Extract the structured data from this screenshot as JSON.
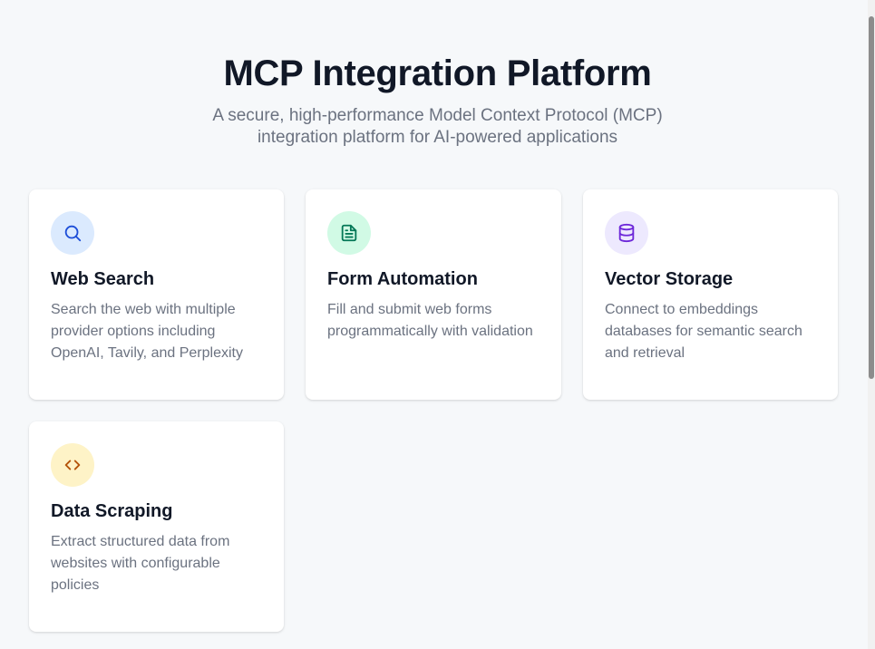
{
  "hero": {
    "title": "MCP Integration Platform",
    "subtitle": "A secure, high-performance Model Context Protocol (MCP) integration platform for AI-powered applications"
  },
  "features": [
    {
      "title": "Web Search",
      "description": "Search the web with multiple provider options including OpenAI, Tavily, and Perplexity",
      "icon": "search-icon",
      "icon_bg": "#dbeafe",
      "icon_color": "#1d4ed8"
    },
    {
      "title": "Form Automation",
      "description": "Fill and submit web forms programmatically with validation",
      "icon": "document-icon",
      "icon_bg": "#d1fae5",
      "icon_color": "#047857"
    },
    {
      "title": "Vector Storage",
      "description": "Connect to embeddings databases for semantic search and retrieval",
      "icon": "database-icon",
      "icon_bg": "#ede9fe",
      "icon_color": "#6d28d9"
    },
    {
      "title": "Data Scraping",
      "description": "Extract structured data from websites with configurable policies",
      "icon": "code-icon",
      "icon_bg": "#fef3c7",
      "icon_color": "#b45309"
    }
  ]
}
